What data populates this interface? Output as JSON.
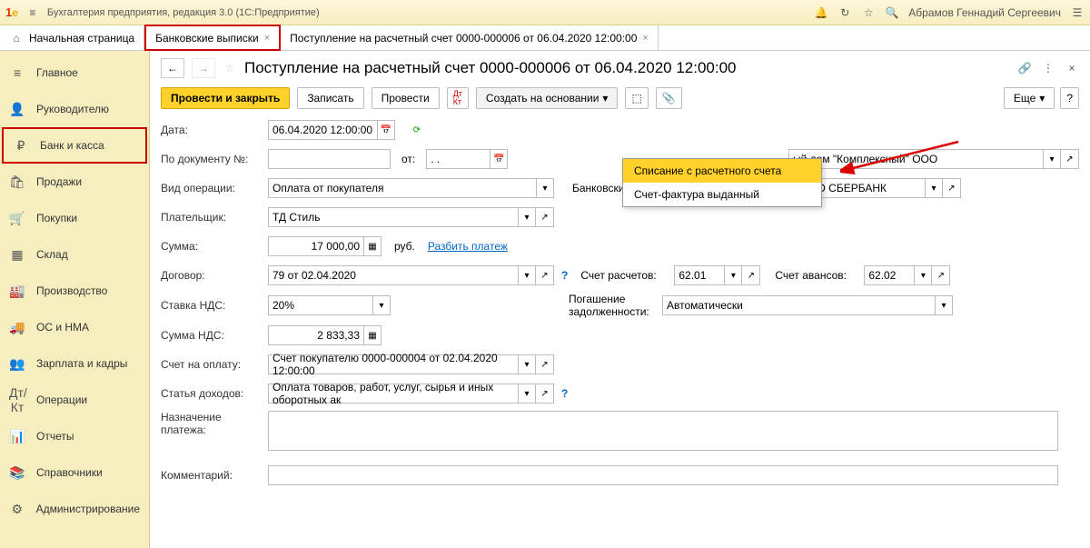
{
  "app": {
    "title": "Бухгалтерия предприятия, редакция 3.0   (1С:Предприятие)",
    "user": "Абрамов Геннадий Сергеевич"
  },
  "tabs": {
    "home": "Начальная страница",
    "t1": "Банковские выписки",
    "t2": "Поступление на расчетный счет 0000-000006 от 06.04.2020 12:00:00"
  },
  "sidebar": [
    {
      "icon": "≡",
      "label": "Главное"
    },
    {
      "icon": "👤",
      "label": "Руководителю"
    },
    {
      "icon": "₽",
      "label": "Банк и касса",
      "hl": true
    },
    {
      "icon": "🛍",
      "label": "Продажи"
    },
    {
      "icon": "🛒",
      "label": "Покупки"
    },
    {
      "icon": "▦",
      "label": "Склад"
    },
    {
      "icon": "🏭",
      "label": "Производство"
    },
    {
      "icon": "🚚",
      "label": "ОС и НМА"
    },
    {
      "icon": "👥",
      "label": "Зарплата и кадры"
    },
    {
      "icon": "Дт/Кт",
      "label": "Операции"
    },
    {
      "icon": "📊",
      "label": "Отчеты"
    },
    {
      "icon": "📚",
      "label": "Справочники"
    },
    {
      "icon": "⚙",
      "label": "Администрирование"
    }
  ],
  "doc": {
    "title": "Поступление на расчетный счет 0000-000006 от 06.04.2020 12:00:00",
    "btn_post_close": "Провести и закрыть",
    "btn_save": "Записать",
    "btn_post": "Провести",
    "btn_create_based": "Создать на основании",
    "btn_more": "Еще",
    "dropdown": {
      "i1": "Списание с расчетного счета",
      "i2": "Счет-фактура выданный"
    }
  },
  "form": {
    "date_lbl": "Дата:",
    "date_val": "06.04.2020 12:00:00",
    "docnum_lbl": "По документу №:",
    "docnum_val": "",
    "from_lbl": "от:",
    "from_val": ".  .",
    "org_rest": "ый дом \"Комплексный\" ООО",
    "optype_lbl": "Вид операции:",
    "optype_val": "Оплата от покупателя",
    "bank_lbl": "Банковский счет:",
    "bank_val": "40702810399994349242, ПАО СБЕРБАНК",
    "payer_lbl": "Плательщик:",
    "payer_val": "ТД Стиль",
    "sum_lbl": "Сумма:",
    "sum_val": "17 000,00",
    "rub": "руб.",
    "split": "Разбить платеж",
    "contract_lbl": "Договор:",
    "contract_val": "79 от 02.04.2020",
    "acc_settle_lbl": "Счет расчетов:",
    "acc_settle_val": "62.01",
    "acc_adv_lbl": "Счет авансов:",
    "acc_adv_val": "62.02",
    "vat_lbl": "Ставка НДС:",
    "vat_val": "20%",
    "debt_lbl": "Погашение задолженности:",
    "debt_val": "Автоматически",
    "vatsum_lbl": "Сумма НДС:",
    "vatsum_val": "2 833,33",
    "invoice_lbl": "Счет на оплату:",
    "invoice_val": "Счет покупателю 0000-000004 от 02.04.2020 12:00:00",
    "income_lbl": "Статья доходов:",
    "income_val": "Оплата товаров, работ, услуг, сырья и иных оборотных ак",
    "purpose_lbl": "Назначение платежа:",
    "comment_lbl": "Комментарий:"
  }
}
